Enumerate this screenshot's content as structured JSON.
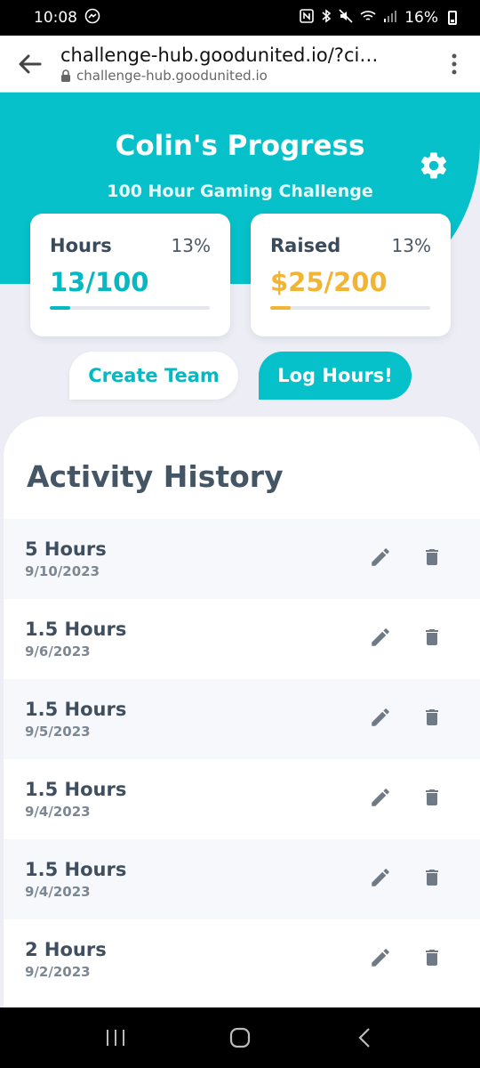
{
  "statusbar": {
    "time": "10:08",
    "battery": "16%"
  },
  "browser": {
    "url": "challenge-hub.goodunited.io/?ci…",
    "domain": "challenge-hub.goodunited.io"
  },
  "header": {
    "title": "Colin's Progress",
    "subtitle": "100 Hour Gaming Challenge"
  },
  "cards": {
    "hours": {
      "label": "Hours",
      "percent": "13%",
      "value": "13/100",
      "progress": 0.13
    },
    "raised": {
      "label": "Raised",
      "percent": "13%",
      "value": "$25/200",
      "progress": 0.13
    }
  },
  "buttons": {
    "create_team": "Create Team",
    "log_hours": "Log Hours!"
  },
  "activity": {
    "title": "Activity History",
    "items": [
      {
        "hours": "5 Hours",
        "date": "9/10/2023"
      },
      {
        "hours": "1.5 Hours",
        "date": "9/6/2023"
      },
      {
        "hours": "1.5 Hours",
        "date": "9/5/2023"
      },
      {
        "hours": "1.5 Hours",
        "date": "9/4/2023"
      },
      {
        "hours": "1.5 Hours",
        "date": "9/4/2023"
      },
      {
        "hours": "2 Hours",
        "date": "9/2/2023"
      }
    ]
  },
  "colors": {
    "accent": "#06c1c9",
    "gold": "#f2b533",
    "text": "#445566"
  }
}
